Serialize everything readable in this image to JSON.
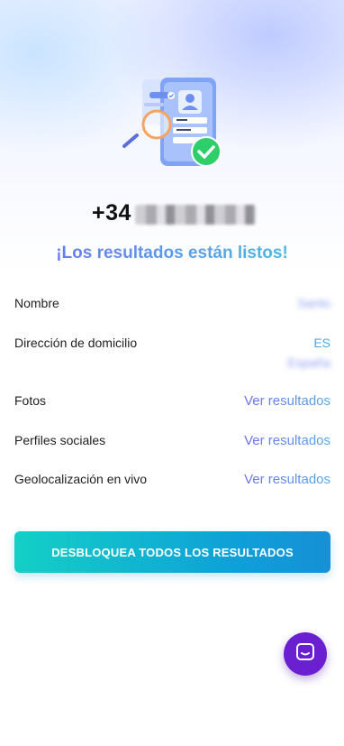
{
  "header": {
    "phone_prefix": "+34",
    "headline": "¡Los resultados están listos!"
  },
  "results": {
    "rows": [
      {
        "label": "Nombre",
        "value": "Santo"
      },
      {
        "label": "Dirección de domicilio",
        "value": "ES",
        "value_secondary": "España"
      },
      {
        "label": "Fotos",
        "value": "Ver resultados"
      },
      {
        "label": "Perfiles sociales",
        "value": "Ver resultados"
      },
      {
        "label": "Geolocalización en vivo",
        "value": "Ver resultados"
      }
    ]
  },
  "cta": {
    "label": "DESBLOQUEA TODOS LOS RESULTADOS"
  },
  "icons": {
    "hero": "phone-search-verified-illustration",
    "chat": "chat-bubble-icon"
  },
  "colors": {
    "accent_purple": "#6d6ef0",
    "accent_teal": "#13d0c6",
    "chat_button": "#6a1fd0",
    "check_green": "#2ecf6a"
  }
}
